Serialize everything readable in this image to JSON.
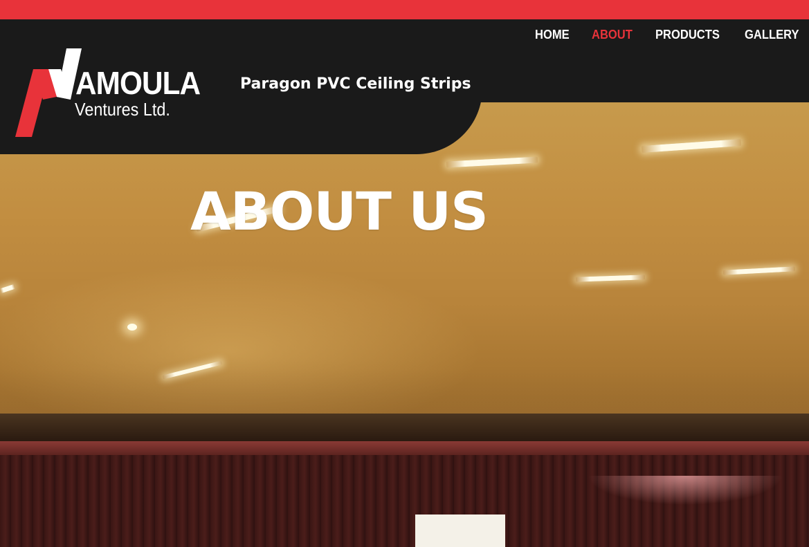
{
  "brand": {
    "name": "AMOULA",
    "subtitle": "Ventures Ltd.",
    "tagline": "Paragon PVC Ceiling Strips",
    "colors": {
      "accent": "#e8333a",
      "header_bg": "#1a1a1a"
    }
  },
  "nav": {
    "items": [
      {
        "label": "HOME",
        "active": false
      },
      {
        "label": "ABOUT",
        "active": true
      },
      {
        "label": "PRODUCTS",
        "active": false
      },
      {
        "label": "GALLERY",
        "active": false
      }
    ]
  },
  "hero": {
    "title": "ABOUT US"
  }
}
